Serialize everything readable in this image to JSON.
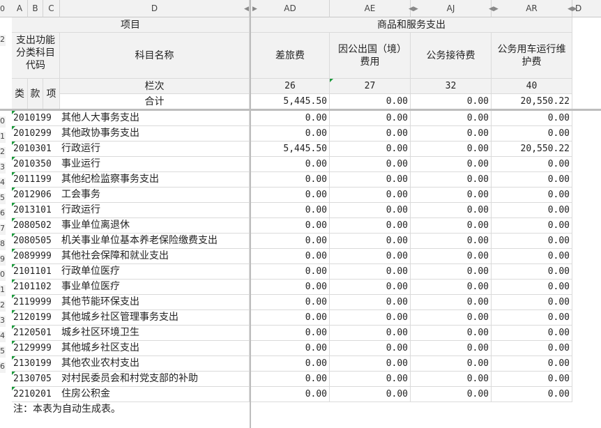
{
  "columns": {
    "a": "A",
    "b": "B",
    "c": "C",
    "d": "D",
    "ad": "AD",
    "ae": "AE",
    "aj": "AJ",
    "ar": "AR",
    "d2": "D"
  },
  "row_numbers": [
    "0",
    "2",
    "",
    "",
    "",
    "",
    "0",
    "1",
    "2",
    "3",
    "4",
    "5",
    "6",
    "7",
    "8",
    "9",
    "0",
    "1",
    "2",
    "3",
    "4",
    "5",
    "6"
  ],
  "header": {
    "project": "项目",
    "group": "商品和服务支出",
    "func_class": "支出功能分类科目代码",
    "subject_name": "科目名称",
    "col_lei": "类",
    "col_kuan": "款",
    "col_xiang": "项",
    "lanci": "栏次",
    "heji": "合计",
    "cols": [
      "差旅费",
      "因公出国（境）费用",
      "公务接待费",
      "公务用车运行维护费"
    ],
    "col_nums": [
      "26",
      "27",
      "32",
      "40"
    ],
    "totals": [
      "5,445.50",
      "0.00",
      "0.00",
      "20,550.22"
    ]
  },
  "rows": [
    {
      "code": "2010199",
      "name": "其他人大事务支出",
      "v": [
        "0.00",
        "0.00",
        "0.00",
        "0.00"
      ]
    },
    {
      "code": "2010299",
      "name": "其他政协事务支出",
      "v": [
        "0.00",
        "0.00",
        "0.00",
        "0.00"
      ]
    },
    {
      "code": "2010301",
      "name": "行政运行",
      "v": [
        "5,445.50",
        "0.00",
        "0.00",
        "20,550.22"
      ]
    },
    {
      "code": "2010350",
      "name": "事业运行",
      "v": [
        "0.00",
        "0.00",
        "0.00",
        "0.00"
      ]
    },
    {
      "code": "2011199",
      "name": "其他纪检监察事务支出",
      "v": [
        "0.00",
        "0.00",
        "0.00",
        "0.00"
      ]
    },
    {
      "code": "2012906",
      "name": "工会事务",
      "v": [
        "0.00",
        "0.00",
        "0.00",
        "0.00"
      ]
    },
    {
      "code": "2013101",
      "name": "行政运行",
      "v": [
        "0.00",
        "0.00",
        "0.00",
        "0.00"
      ]
    },
    {
      "code": "2080502",
      "name": "事业单位离退休",
      "v": [
        "0.00",
        "0.00",
        "0.00",
        "0.00"
      ]
    },
    {
      "code": "2080505",
      "name": "机关事业单位基本养老保险缴费支出",
      "v": [
        "0.00",
        "0.00",
        "0.00",
        "0.00"
      ]
    },
    {
      "code": "2089999",
      "name": "其他社会保障和就业支出",
      "v": [
        "0.00",
        "0.00",
        "0.00",
        "0.00"
      ]
    },
    {
      "code": "2101101",
      "name": "行政单位医疗",
      "v": [
        "0.00",
        "0.00",
        "0.00",
        "0.00"
      ]
    },
    {
      "code": "2101102",
      "name": "事业单位医疗",
      "v": [
        "0.00",
        "0.00",
        "0.00",
        "0.00"
      ]
    },
    {
      "code": "2119999",
      "name": "其他节能环保支出",
      "v": [
        "0.00",
        "0.00",
        "0.00",
        "0.00"
      ]
    },
    {
      "code": "2120199",
      "name": "其他城乡社区管理事务支出",
      "v": [
        "0.00",
        "0.00",
        "0.00",
        "0.00"
      ]
    },
    {
      "code": "2120501",
      "name": "城乡社区环境卫生",
      "v": [
        "0.00",
        "0.00",
        "0.00",
        "0.00"
      ]
    },
    {
      "code": "2129999",
      "name": "其他城乡社区支出",
      "v": [
        "0.00",
        "0.00",
        "0.00",
        "0.00"
      ]
    },
    {
      "code": "2130199",
      "name": "其他农业农村支出",
      "v": [
        "0.00",
        "0.00",
        "0.00",
        "0.00"
      ]
    },
    {
      "code": "2130705",
      "name": "对村民委员会和村党支部的补助",
      "v": [
        "0.00",
        "0.00",
        "0.00",
        "0.00"
      ]
    },
    {
      "code": "2210201",
      "name": "住房公积金",
      "v": [
        "0.00",
        "0.00",
        "0.00",
        "0.00"
      ]
    }
  ],
  "note": "注：本表为自动生成表。"
}
